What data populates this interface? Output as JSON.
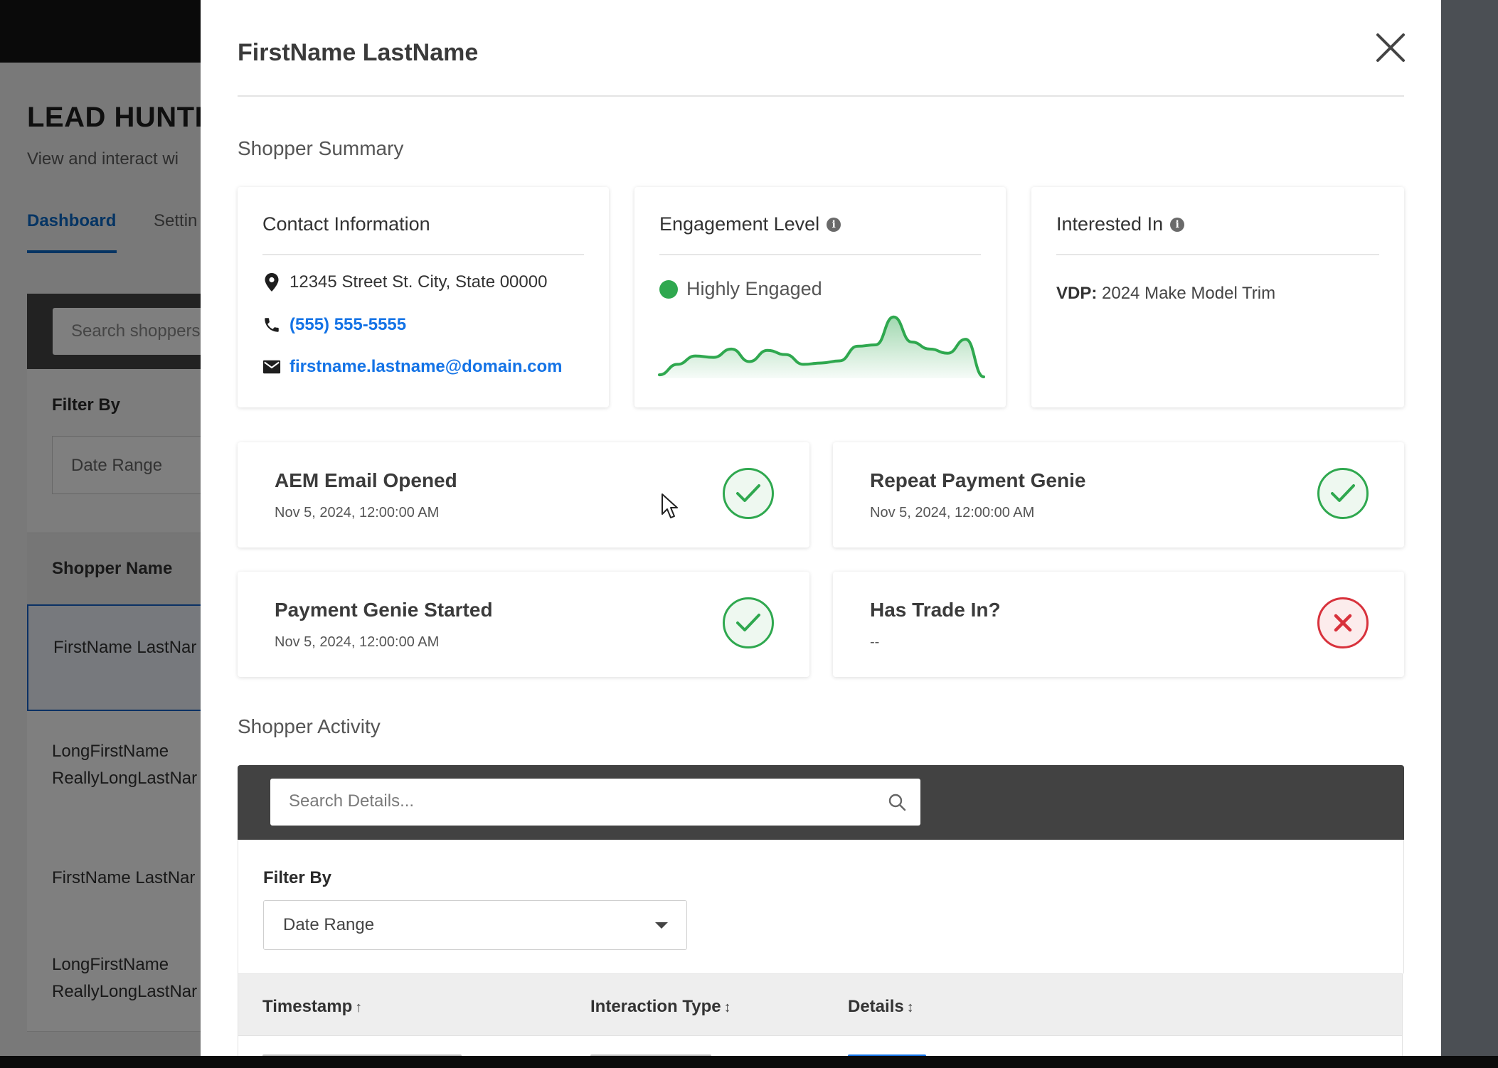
{
  "background": {
    "title": "LEAD HUNTE",
    "subtitle": "View and interact wi",
    "tabs": {
      "active": "Dashboard",
      "other": "Settin"
    },
    "search_placeholder": "Search shoppers",
    "filter_label": "Filter By",
    "date_range": "Date Range",
    "column_header": "Shopper Name",
    "rows": [
      "FirstName LastNar",
      "LongFirstName\nReallyLongLastNar",
      "FirstName LastNar",
      "LongFirstName\nReallyLongLastNar"
    ]
  },
  "modal": {
    "title": "FirstName LastName",
    "summary_heading": "Shopper Summary",
    "contact": {
      "title": "Contact Information",
      "address": "12345 Street St. City, State 00000",
      "phone": "(555) 555-5555",
      "email": "firstname.lastname@domain.com"
    },
    "engagement": {
      "title": "Engagement Level",
      "level": "Highly Engaged",
      "color": "#2fa84f",
      "sparkline": [
        0.05,
        0.2,
        0.32,
        0.3,
        0.42,
        0.24,
        0.4,
        0.34,
        0.2,
        0.22,
        0.25,
        0.46,
        0.48,
        0.88,
        0.52,
        0.42,
        0.36,
        0.56,
        0.02
      ]
    },
    "interested": {
      "title": "Interested In",
      "label": "VDP:",
      "value": "2024 Make Model Trim"
    },
    "statuses": [
      {
        "title": "AEM Email Opened",
        "sub": "Nov 5, 2024, 12:00:00 AM",
        "state": "check"
      },
      {
        "title": "Repeat Payment Genie",
        "sub": "Nov 5, 2024, 12:00:00 AM",
        "state": "check"
      },
      {
        "title": "Payment Genie Started",
        "sub": "Nov 5, 2024, 12:00:00 AM",
        "state": "check"
      },
      {
        "title": "Has Trade In?",
        "sub": "--",
        "state": "x"
      }
    ],
    "activity": {
      "heading": "Shopper Activity",
      "search_placeholder": "Search Details...",
      "filter_label": "Filter By",
      "date_range": "Date Range",
      "columns": [
        "Timestamp",
        "Interaction Type",
        "Details"
      ]
    }
  },
  "colors": {
    "success": "#2fa84f",
    "error": "#d8323c",
    "link": "#1473e6",
    "accent": "#0a69c7"
  }
}
